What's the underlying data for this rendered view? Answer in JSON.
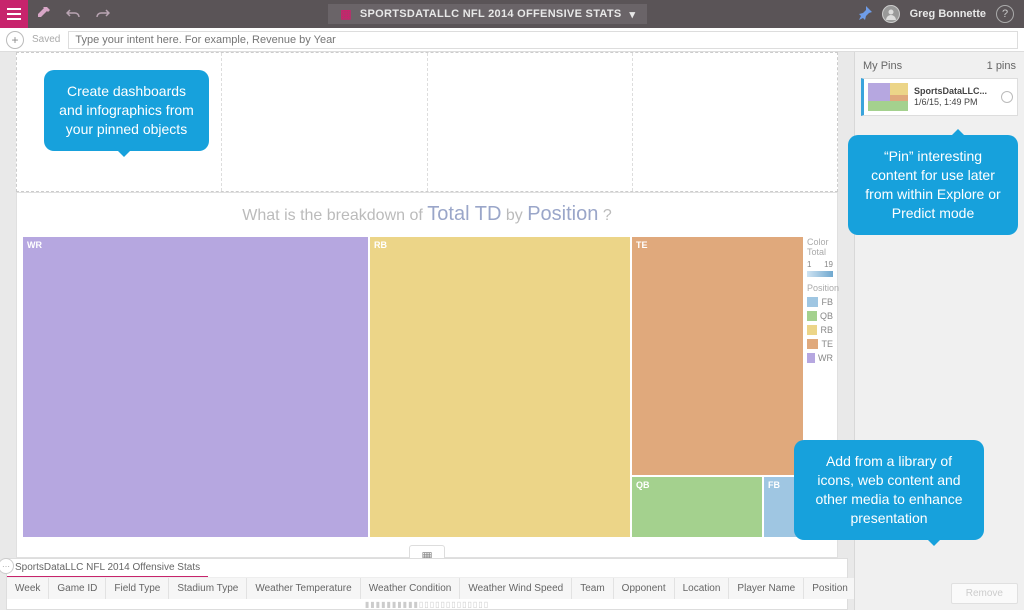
{
  "topbar": {
    "title": "SPORTSDATALLC NFL 2014 OFFENSIVE STATS",
    "user": "Greg Bonnette"
  },
  "intent": {
    "saved": "Saved",
    "placeholder": "Type your intent here. For example, Revenue by Year"
  },
  "chart": {
    "question_prefix": "What is the breakdown of",
    "metric": "Total TD",
    "by_word": "by",
    "dimension": "Position",
    "question_suffix": "?",
    "legend_title_1": "Color",
    "legend_title_2": "Total",
    "legend_low": "1",
    "legend_high": "19",
    "legend_dim": "Position",
    "tiles": {
      "wr": "WR",
      "rb": "RB",
      "te": "TE",
      "qb": "QB",
      "fb": "FB"
    },
    "legend_items": [
      "FB",
      "QB",
      "RB",
      "TE",
      "WR"
    ]
  },
  "chart_data": {
    "type": "treemap",
    "title": "What is the breakdown of Total TD by Position?",
    "dimension": "Position",
    "measure": "Total TD",
    "color_scale": {
      "label": "Total",
      "min": 1,
      "max": 19
    },
    "items": [
      {
        "position": "WR",
        "value_rank": 1,
        "color": "#b6a7e0"
      },
      {
        "position": "RB",
        "value_rank": 2,
        "color": "#ecd588"
      },
      {
        "position": "TE",
        "value_rank": 3,
        "color": "#e0a97c"
      },
      {
        "position": "QB",
        "value_rank": 4,
        "color": "#a4d18e"
      },
      {
        "position": "FB",
        "value_rank": 5,
        "color": "#9fc6e2"
      }
    ]
  },
  "source": {
    "tab": "SportsDataLLC NFL 2014 Offensive Stats",
    "columns": [
      "Week",
      "Game ID",
      "Field Type",
      "Stadium Type",
      "Weather Temperature",
      "Weather Condition",
      "Weather Wind Speed",
      "Team",
      "Opponent",
      "Location",
      "Player Name",
      "Position"
    ]
  },
  "pins": {
    "header": "My Pins",
    "count": "1 pins",
    "card_title": "SportsDataLLC...",
    "card_time": "1/6/15, 1:49 PM"
  },
  "callouts": {
    "c1": "Create dashboards and infographics from your pinned objects",
    "c2": "“Pin” interesting content for use later from within Explore or Predict mode",
    "c3": "Add from a library of icons, web content and other media to enhance presentation"
  },
  "buttons": {
    "remove": "Remove"
  },
  "legend_colors": {
    "FB": "#9fc6e2",
    "QB": "#a4d18e",
    "RB": "#ecd588",
    "TE": "#e0a97c",
    "WR": "#b6a7e0"
  }
}
